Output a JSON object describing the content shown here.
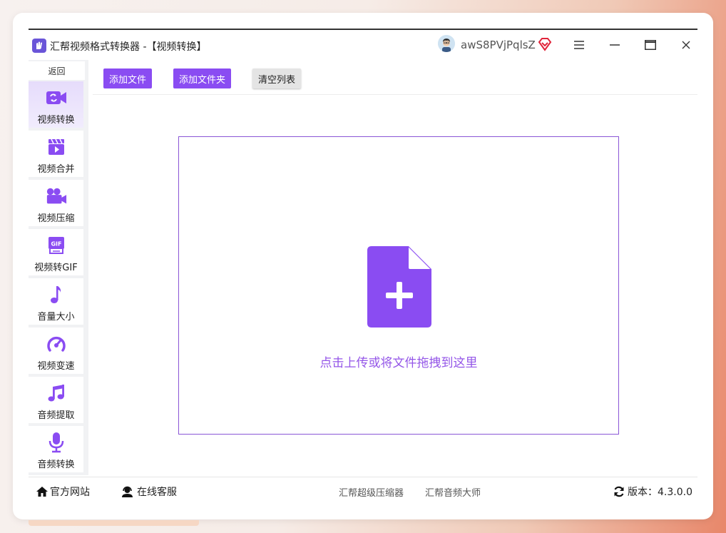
{
  "app": {
    "title": "汇帮视频格式转换器   -【视频转换】",
    "username": "awS8PVjPqlsZ"
  },
  "sidebar": {
    "back_label": "返回",
    "items": [
      {
        "label": "视频转换",
        "icon": "video-convert-icon",
        "active": true
      },
      {
        "label": "视频合并",
        "icon": "clapperboard-icon",
        "active": false
      },
      {
        "label": "视频压缩",
        "icon": "video-camera-icon",
        "active": false
      },
      {
        "label": "视频转GIF",
        "icon": "gif-icon",
        "active": false
      },
      {
        "label": "音量大小",
        "icon": "music-note-icon",
        "active": false
      },
      {
        "label": "视频变速",
        "icon": "speedometer-icon",
        "active": false
      },
      {
        "label": "音频提取",
        "icon": "music-notes-icon",
        "active": false
      },
      {
        "label": "音频转换",
        "icon": "microphone-icon",
        "active": false
      }
    ]
  },
  "toolbar": {
    "add_file": "添加文件",
    "add_folder": "添加文件夹",
    "clear_list": "清空列表"
  },
  "dropzone": {
    "hint": "点击上传或将文件拖拽到这里",
    "icon": "file-plus-icon"
  },
  "footer": {
    "website": "官方网站",
    "support": "在线客服",
    "link1": "汇帮超级压缩器",
    "link2": "汇帮音频大师",
    "version": "版本：4.3.0.0"
  },
  "colors": {
    "accent": "#8a4cf2",
    "active_bg": "#e6dcfb",
    "vip": "#e0243a"
  }
}
